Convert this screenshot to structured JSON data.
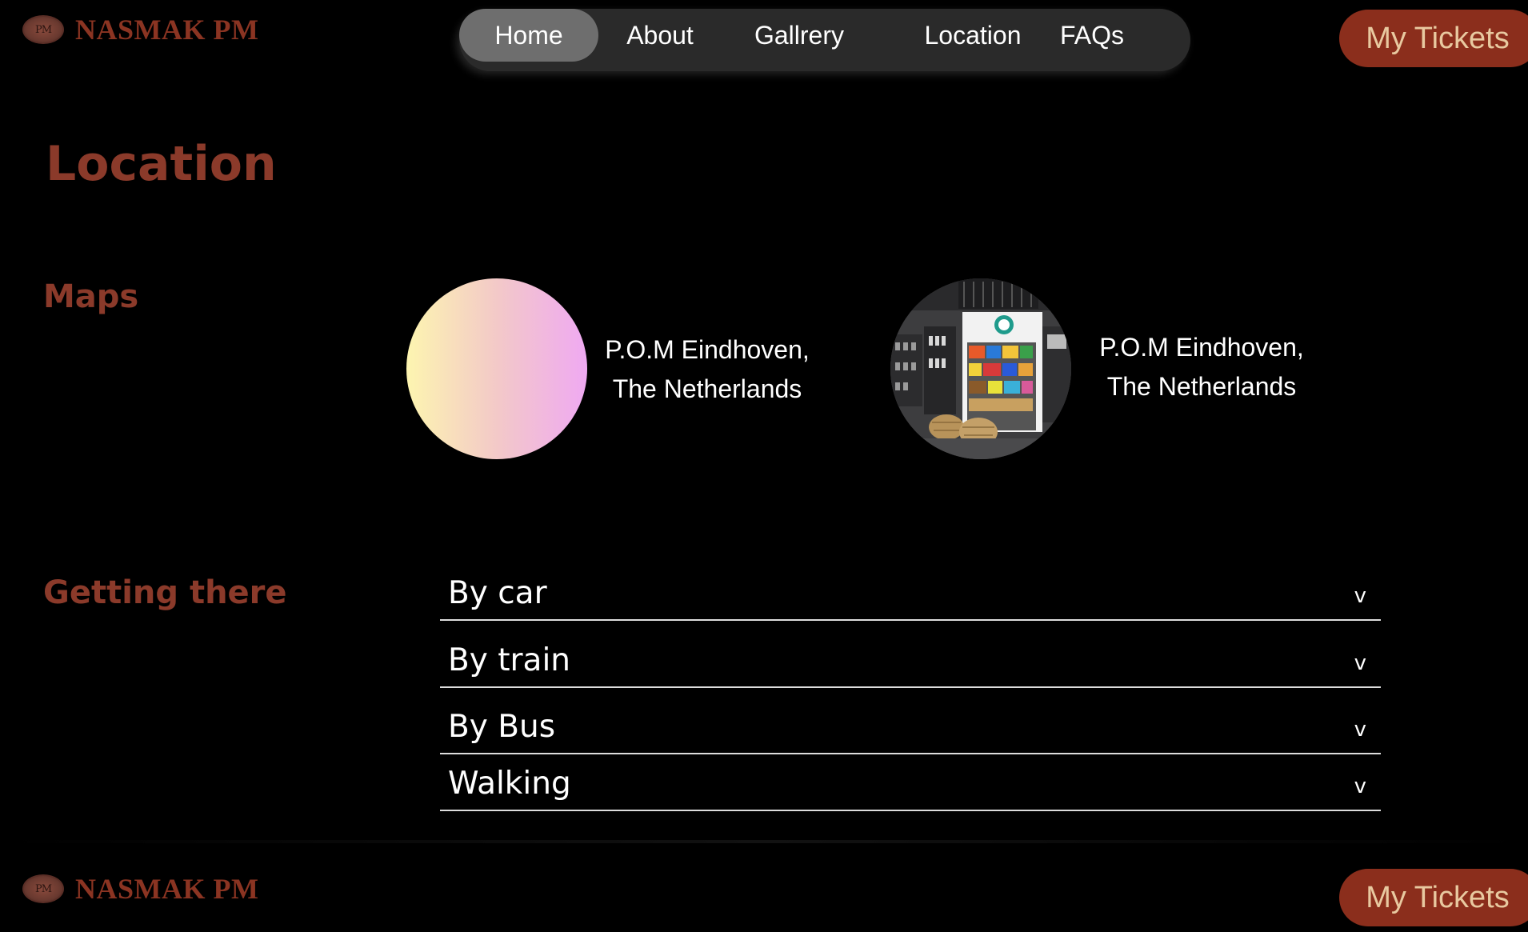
{
  "brand": {
    "logo_text": "NASMAK PM",
    "badge_text": "PM",
    "color": "#8b3422"
  },
  "nav": {
    "items": [
      {
        "label": "Home",
        "active": true
      },
      {
        "label": "About"
      },
      {
        "label": "Gallrery"
      },
      {
        "label": "Location"
      },
      {
        "label": "FAQs"
      }
    ]
  },
  "header": {
    "tickets_label": "My Tickets"
  },
  "main": {
    "title": "Location",
    "maps": {
      "heading": "Maps",
      "cards": [
        {
          "caption_line1": "P.O.M Eindhoven,",
          "caption_line2": "The Netherlands",
          "image": "gradient-placeholder"
        },
        {
          "caption_line1": "P.O.M Eindhoven,",
          "caption_line2": "The Netherlands",
          "image": "shop-interior-photo"
        }
      ]
    },
    "getting_there": {
      "heading": "Getting there",
      "items": [
        {
          "label": "By car",
          "chevron": "v"
        },
        {
          "label": "By train",
          "chevron": "v"
        },
        {
          "label": "By Bus",
          "chevron": "v"
        },
        {
          "label": "Walking",
          "chevron": "v"
        }
      ]
    }
  },
  "footer": {
    "logo_text": "NASMAK PM",
    "badge_text": "PM",
    "tickets_label": "My Tickets"
  },
  "colors": {
    "accent": "#8b3a2a",
    "button_bg": "#8b2e1c",
    "button_text": "#e8c9a0",
    "nav_bg": "#2a2a2a",
    "nav_active": "#6e6e6e"
  }
}
